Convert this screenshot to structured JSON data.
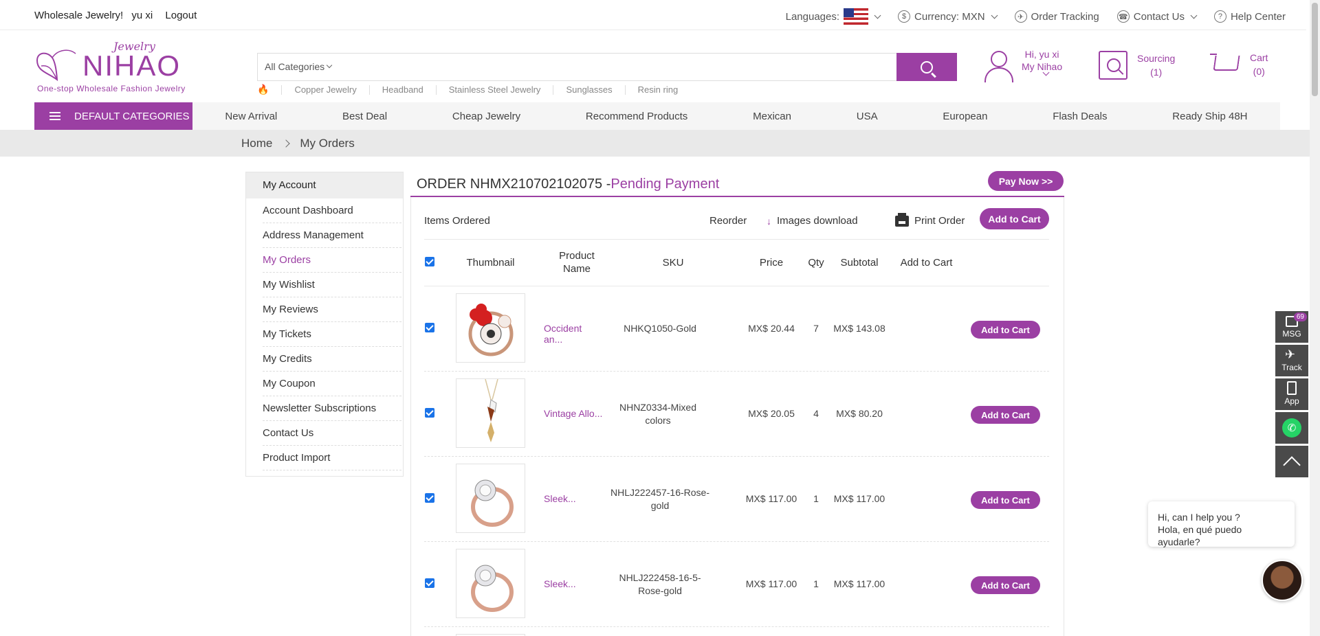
{
  "topbar": {
    "greeting": "Wholesale Jewelry!",
    "username": "yu xi",
    "logout": "Logout",
    "languages_label": "Languages:",
    "currency": "Currency: MXN",
    "order_tracking": "Order Tracking",
    "contact_us": "Contact Us",
    "help_center": "Help Center"
  },
  "logo": {
    "script": "Jewelry",
    "name": "NIHAO",
    "tagline": "One-stop Wholesale Fashion Jewelry"
  },
  "search": {
    "category": "All Categories",
    "value": "",
    "hotwords": [
      "Copper Jewelry",
      "Headband",
      "Stainless Steel Jewelry",
      "Sunglasses",
      "Resin ring"
    ]
  },
  "account": {
    "hi": "Hi, yu xi",
    "my": "My Nihao"
  },
  "sourcing": {
    "label": "Sourcing",
    "count": "(1)"
  },
  "cart": {
    "label": "Cart",
    "count": "(0)"
  },
  "nav": {
    "categories": "DEFAULT CATEGORIES",
    "links": [
      "New Arrival",
      "Best Deal",
      "Cheap Jewelry",
      "Recommend Products",
      "Mexican",
      "USA",
      "European",
      "Flash Deals",
      "Ready Ship 48H"
    ]
  },
  "breadcrumb": {
    "home": "Home",
    "current": "My Orders"
  },
  "sidebar": {
    "title": "My Account",
    "items": [
      "Account Dashboard",
      "Address Management",
      "My Orders",
      "My Wishlist",
      "My Reviews",
      "My Tickets",
      "My Credits",
      "My Coupon",
      "Newsletter Subscriptions",
      "Contact Us",
      "Product Import"
    ],
    "active_index": 2
  },
  "order": {
    "title": "ORDER NHMX210702102075 -",
    "status": "Pending Payment",
    "pay_now": "Pay Now >>",
    "items_ordered": "Items Ordered",
    "reorder": "Reorder",
    "images_download": "Images download",
    "print_order": "Print Order",
    "add_to_cart_all": "Add to Cart",
    "columns": {
      "thumbnail": "Thumbnail",
      "product_name": "Product Name",
      "sku": "SKU",
      "price": "Price",
      "qty": "Qty",
      "subtotal": "Subtotal",
      "add_to_cart": "Add to Cart"
    },
    "rows": [
      {
        "name": "Occident an...",
        "sku": "NHKQ1050-Gold",
        "price": "MX$ 20.44",
        "qty": "7",
        "subtotal": "MX$ 143.08",
        "btn": "Add to Cart"
      },
      {
        "name": "Vintage Allo...",
        "sku": "NHNZ0334-Mixed colors",
        "price": "MX$ 20.05",
        "qty": "4",
        "subtotal": "MX$ 80.20",
        "btn": "Add to Cart"
      },
      {
        "name": "Sleek...",
        "sku": "NHLJ222457-16-Rose-gold",
        "price": "MX$ 117.00",
        "qty": "1",
        "subtotal": "MX$ 117.00",
        "btn": "Add to Cart"
      },
      {
        "name": "Sleek...",
        "sku": "NHLJ222458-16-5-Rose-gold",
        "price": "MX$ 117.00",
        "qty": "1",
        "subtotal": "MX$ 117.00",
        "btn": "Add to Cart"
      }
    ]
  },
  "floats": {
    "msg": "MSG",
    "msg_badge": "69",
    "track": "Track",
    "app": "App"
  },
  "chat": {
    "line1": "Hi, can I help you ?",
    "line2": "Hola, en qué puedo ayudarle?"
  },
  "colors": {
    "brand": "#9b3fa3",
    "nav_bg": "#f5f5f5",
    "crumb_bg": "#e9e9e9"
  }
}
